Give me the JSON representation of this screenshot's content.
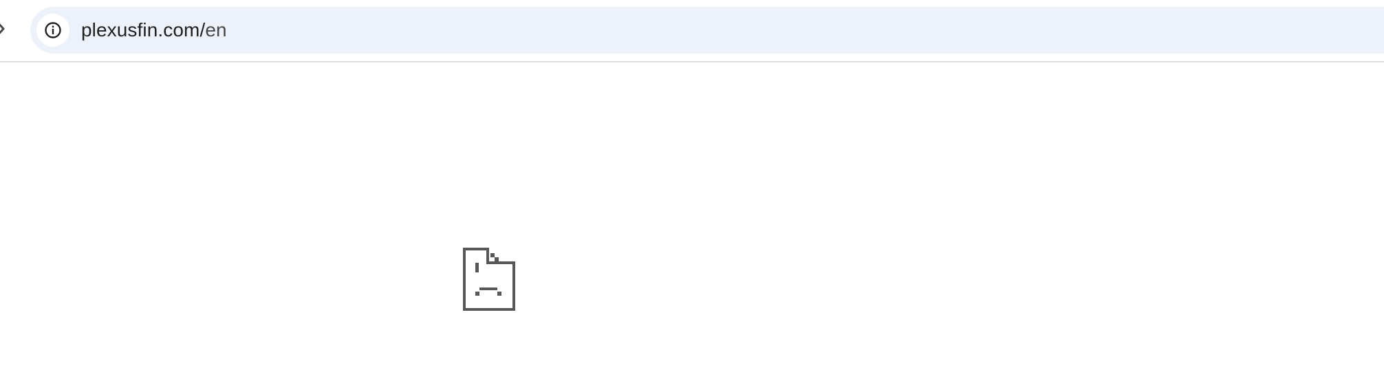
{
  "address_bar": {
    "url_host": "plexusfin.com/",
    "url_path": "en"
  },
  "icons": {
    "site_info": "info-icon",
    "error_page": "sad-page-icon",
    "navigation": "chevron-icon"
  },
  "colors": {
    "omnibox_background": "#edf1f9",
    "icon_gray": "#575757",
    "url_text": "#1f1f1f"
  }
}
